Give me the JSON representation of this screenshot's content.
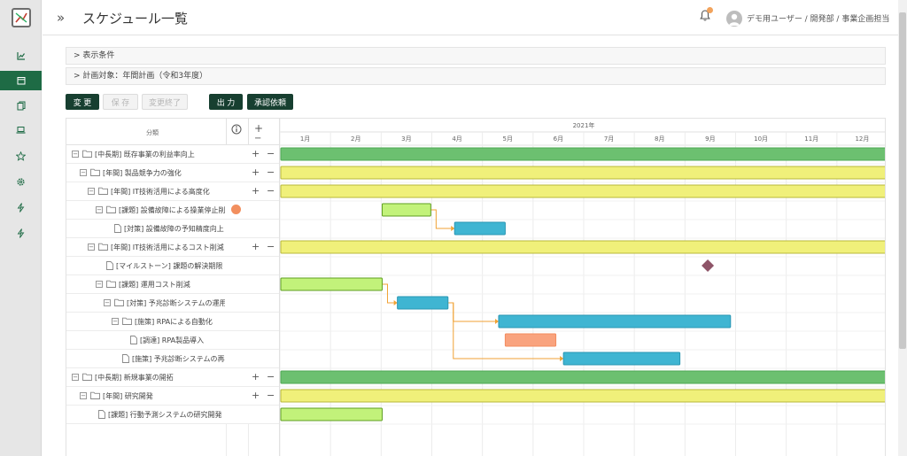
{
  "header": {
    "title": "スケジュール一覧",
    "user": "デモ用ユーザー / 開発部 / 事業企画担当"
  },
  "sidebar": {
    "items": [
      {
        "icon": "chart-icon"
      },
      {
        "icon": "calendar-icon",
        "active": true
      },
      {
        "icon": "documents-icon"
      },
      {
        "icon": "laptop-icon"
      },
      {
        "icon": "star-icon"
      },
      {
        "icon": "gear-icon"
      },
      {
        "icon": "bolt-icon"
      },
      {
        "icon": "bolt-icon"
      }
    ]
  },
  "panels": {
    "display_conditions": "表示条件",
    "plan_target": "計画対象：年間計画（令和3年度）"
  },
  "toolbar": {
    "change": "変 更",
    "save": "保 存",
    "change_end": "変更終了",
    "output": "出 力",
    "approval": "承認依頼"
  },
  "gantt": {
    "column_header": "分類",
    "info_icon": "info-icon",
    "year": "2021年",
    "months": [
      "1月",
      "2月",
      "3月",
      "4月",
      "5月",
      "6月",
      "7月",
      "8月",
      "9月",
      "10月",
      "11月",
      "12月"
    ],
    "rows": [
      {
        "label": "[中長期] 既存事業の利益率向上",
        "level": 0,
        "type": "folder",
        "controls": true
      },
      {
        "label": "[年間] 製品競争力の強化",
        "level": 1,
        "type": "folder",
        "controls": true
      },
      {
        "label": "[年間] IT技術活用による高度化",
        "level": 2,
        "type": "folder",
        "controls": true
      },
      {
        "label": "[課題] 設備故障による操業停止削減",
        "level": 3,
        "type": "folder",
        "controls": false,
        "alert": true
      },
      {
        "label": "[対策] 設備故障の予知精度向上",
        "level": 4,
        "type": "doc",
        "controls": false
      },
      {
        "label": "[年間] IT技術活用によるコスト削減",
        "level": 2,
        "type": "folder",
        "controls": true
      },
      {
        "label": "[マイルストーン]  課題の解決期限",
        "level": 3,
        "type": "doc",
        "controls": false
      },
      {
        "label": "[課題] 運用コスト削減",
        "level": 3,
        "type": "folder",
        "controls": false
      },
      {
        "label": "[対策] 予兆診断システムの運用コスト",
        "level": 4,
        "type": "folder",
        "controls": false
      },
      {
        "label": "[施策] RPAによる自動化",
        "level": 5,
        "type": "folder",
        "controls": false
      },
      {
        "label": "[調達] RPA製品導入",
        "level": 6,
        "type": "doc",
        "controls": false
      },
      {
        "label": "[施策] 予兆診断システムの再構築",
        "level": 5,
        "type": "doc",
        "controls": false
      },
      {
        "label": "[中長期] 新規事業の開拓",
        "level": 0,
        "type": "folder",
        "controls": true
      },
      {
        "label": "[年間] 研究開発",
        "level": 1,
        "type": "folder",
        "controls": true
      },
      {
        "label": "[課題] 行動予測システムの研究開発",
        "level": 2,
        "type": "doc",
        "controls": false
      }
    ]
  },
  "colors": {
    "accent_dark": "#173f30",
    "sidebar_active": "#1e6b45",
    "bar_long_term": "#6cc070",
    "bar_annual": "#f0f07a",
    "bar_issue": "#c2f27a",
    "bar_measure": "#3fb5d2",
    "bar_procure": "#f9a37e",
    "milestone": "#8e5468",
    "dependency": "#f0a234"
  }
}
